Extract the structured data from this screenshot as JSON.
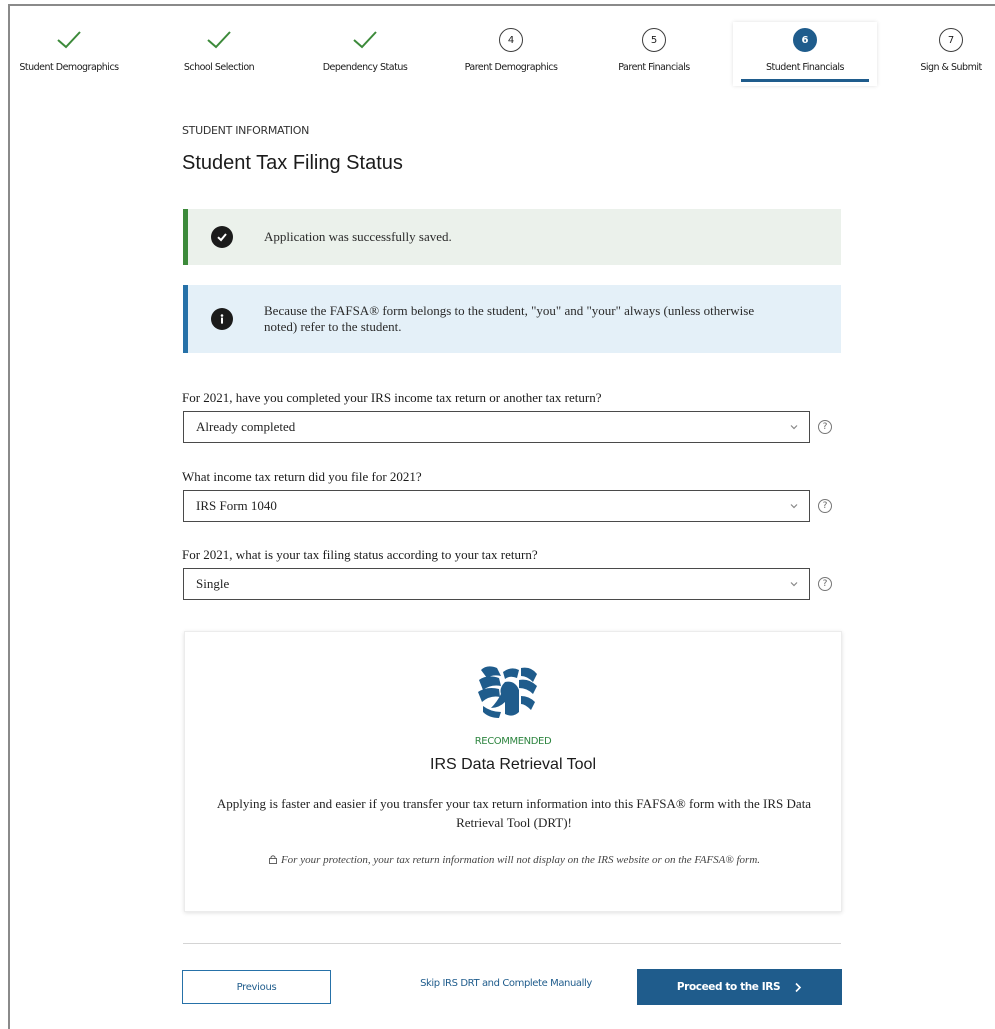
{
  "stepper": {
    "steps": [
      {
        "label": "Student Demographics",
        "status": "complete"
      },
      {
        "label": "School Selection",
        "status": "complete"
      },
      {
        "label": "Dependency Status",
        "status": "complete"
      },
      {
        "label": "Parent Demographics",
        "number": "4",
        "status": "pending"
      },
      {
        "label": "Parent Financials",
        "number": "5",
        "status": "pending"
      },
      {
        "label": "Student Financials",
        "number": "6",
        "status": "current"
      },
      {
        "label": "Sign & Submit",
        "number": "7",
        "status": "pending"
      }
    ]
  },
  "header": {
    "eyebrow": "STUDENT INFORMATION",
    "title": "Student Tax Filing Status"
  },
  "alerts": {
    "success": "Application was successfully saved.",
    "info": "Because the FAFSA® form belongs to the student, \"you\" and \"your\" always (unless otherwise noted) refer to the student."
  },
  "questions": [
    {
      "label": "For 2021, have you completed your IRS income tax return or another tax return?",
      "value": "Already completed"
    },
    {
      "label": "What income tax return did you file for 2021?",
      "value": "IRS Form 1040"
    },
    {
      "label": "For 2021, what is your tax filing status according to your tax return?",
      "value": "Single"
    }
  ],
  "help_symbol": "?",
  "irs": {
    "badge": "RECOMMENDED",
    "title": "IRS Data Retrieval Tool",
    "body": "Applying is faster and easier if you transfer your tax return information into this FAFSA® form with the IRS Data Retrieval Tool (DRT)!",
    "note": "For your protection, your tax return information will not display on the IRS website or on the FAFSA® form."
  },
  "footer": {
    "previous": "Previous",
    "skip": "Skip IRS DRT and Complete Manually",
    "proceed": "Proceed to the IRS"
  },
  "colors": {
    "primary": "#1f5c8c",
    "success_bar": "#3c8a3a",
    "info_bar": "#2671a8",
    "recommended": "#2e8540"
  }
}
